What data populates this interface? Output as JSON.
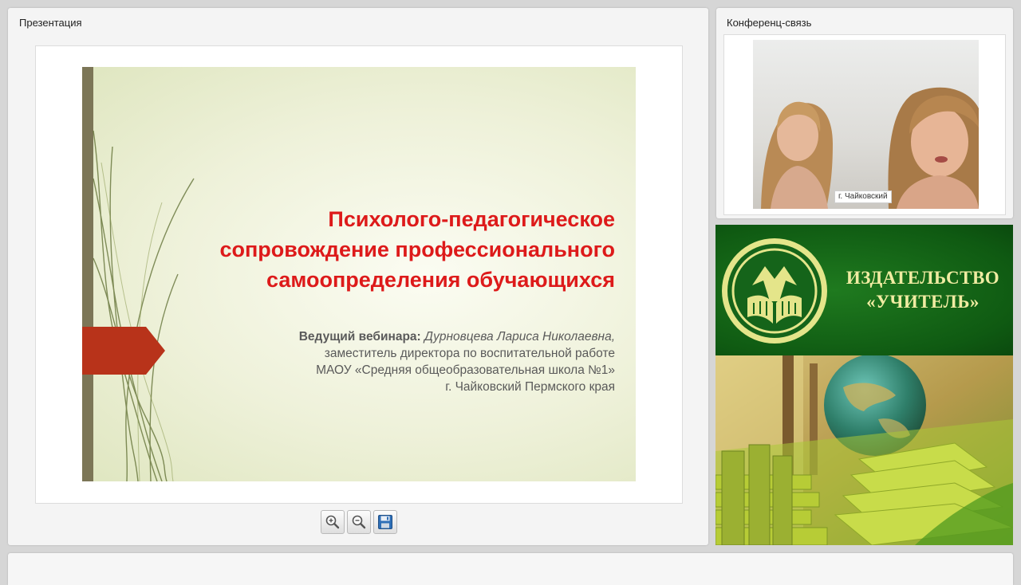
{
  "presentation_panel": {
    "title": "Презентация"
  },
  "slide": {
    "title": "Психолого-педагогическое\nсопровождение профессионального\nсамоопределения обучающихся",
    "presenter_label": "Ведущий вебинара:",
    "presenter_name": "Дурновцева Лариса Николаевна,",
    "presenter_role": "заместитель директора по воспитательной работе",
    "presenter_school": "МАОУ «Средняя общеобразовательная школа №1»",
    "presenter_city": "г. Чайковский Пермского края",
    "colors": {
      "title": "#dd1a1a",
      "accent": "#b8331a",
      "bar": "#7c7657"
    }
  },
  "toolbar": {
    "zoom_in_icon": "zoom-in-icon",
    "zoom_out_icon": "zoom-out-icon",
    "save_icon": "floppy-disk-icon"
  },
  "conference_panel": {
    "title": "Конференц-связь",
    "video_caption": "г. Чайковский"
  },
  "banner": {
    "name_line1": "ИЗДАТЕЛЬСТВО",
    "name_line2": "«УЧИТЕЛЬ»",
    "colors": {
      "green": "#0f5a12",
      "text": "#f0eca2"
    }
  }
}
